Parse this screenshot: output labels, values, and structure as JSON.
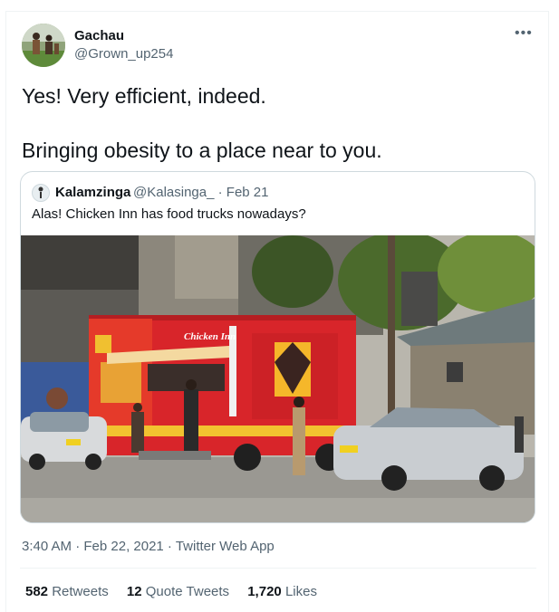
{
  "tweet": {
    "author_name": "Gachau",
    "author_handle": "@Grown_up254",
    "more_icon": "•••",
    "text_line1": "Yes! Very efficient, indeed.",
    "text_line2": "Bringing obesity to a place near to you.",
    "timestamp": "3:40 AM · Feb 22, 2021 · Twitter Web App"
  },
  "quoted": {
    "author_name": "Kalamzinga",
    "author_handle": "@Kalasinga_ · Feb 21",
    "text": "Alas! Chicken Inn has food trucks nowadays?",
    "image": {
      "truck_sign": "Chicken Inn",
      "plate_left": "",
      "plate_right": ""
    }
  },
  "stats": {
    "retweets_count": "582",
    "retweets_label": "Retweets",
    "quotes_count": "12",
    "quotes_label": "Quote Tweets",
    "likes_count": "1,720",
    "likes_label": "Likes"
  },
  "colors": {
    "secondary_text": "#536471",
    "border": "#cfd9de",
    "truck_red": "#d8252a"
  }
}
